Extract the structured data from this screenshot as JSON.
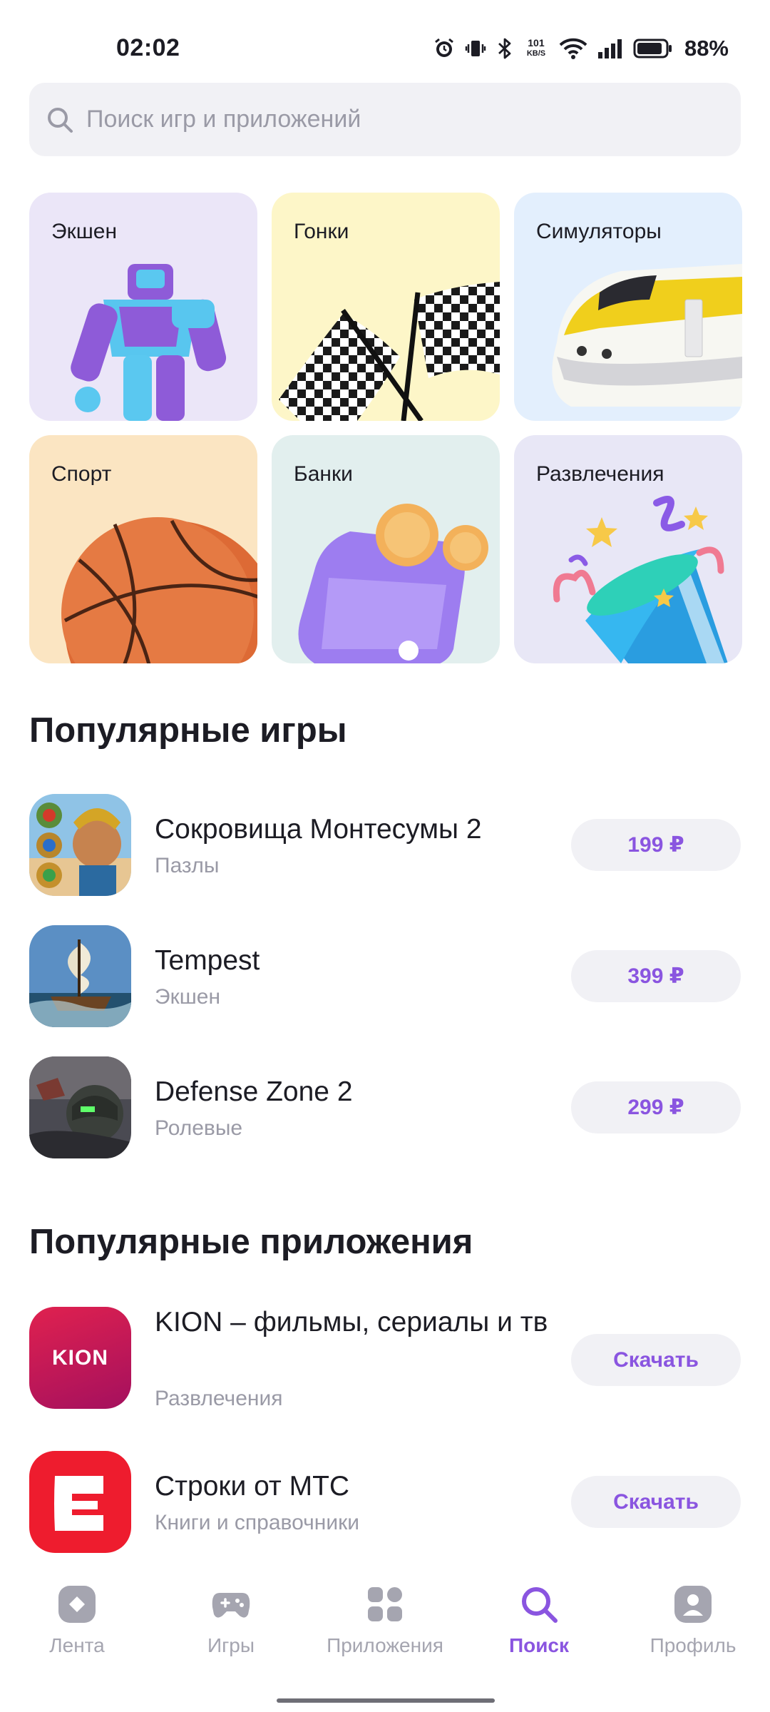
{
  "status_bar": {
    "time": "02:02",
    "net_speed_value": "101",
    "net_speed_unit": "KB/S",
    "battery": "88%"
  },
  "search": {
    "placeholder": "Поиск игр и приложений",
    "icon": "search-icon"
  },
  "categories": [
    {
      "label": "Экшен",
      "bg": "#ebe6f8",
      "illustration": "robot"
    },
    {
      "label": "Гонки",
      "bg": "#fdf6c8",
      "illustration": "checkered-flags"
    },
    {
      "label": "Симуляторы",
      "bg": "#e3effd",
      "illustration": "train"
    },
    {
      "label": "Спорт",
      "bg": "#fbe5c2",
      "illustration": "basketball"
    },
    {
      "label": "Банки",
      "bg": "#e2efee",
      "illustration": "wallet-coins"
    },
    {
      "label": "Развлечения",
      "bg": "#e8e7f6",
      "illustration": "party-popper"
    }
  ],
  "popular_games": {
    "title": "Популярные игры",
    "items": [
      {
        "name": "Сокровища Монтесумы 2",
        "category": "Пазлы",
        "price": "199 ₽"
      },
      {
        "name": "Tempest",
        "category": "Экшен",
        "price": "399 ₽"
      },
      {
        "name": "Defense Zone 2",
        "category": "Ролевые",
        "price": "299 ₽"
      }
    ]
  },
  "popular_apps": {
    "title": "Популярные приложения",
    "items": [
      {
        "name": "KION – фильмы, сериалы и тв",
        "category": "Развлечения",
        "action": "Скачать",
        "icon_text": "KION"
      },
      {
        "name": "Строки от МТС",
        "category": "Книги и справочники",
        "action": "Скачать"
      }
    ]
  },
  "bottom_nav": {
    "items": [
      {
        "label": "Лента",
        "icon": "feed-icon"
      },
      {
        "label": "Игры",
        "icon": "gamepad-icon"
      },
      {
        "label": "Приложения",
        "icon": "apps-grid-icon"
      },
      {
        "label": "Поиск",
        "icon": "search-icon",
        "active": true
      },
      {
        "label": "Профиль",
        "icon": "profile-icon"
      }
    ]
  },
  "colors": {
    "accent": "#8a55e0",
    "muted": "#9a9aa6",
    "surface": "#f1f1f5"
  }
}
